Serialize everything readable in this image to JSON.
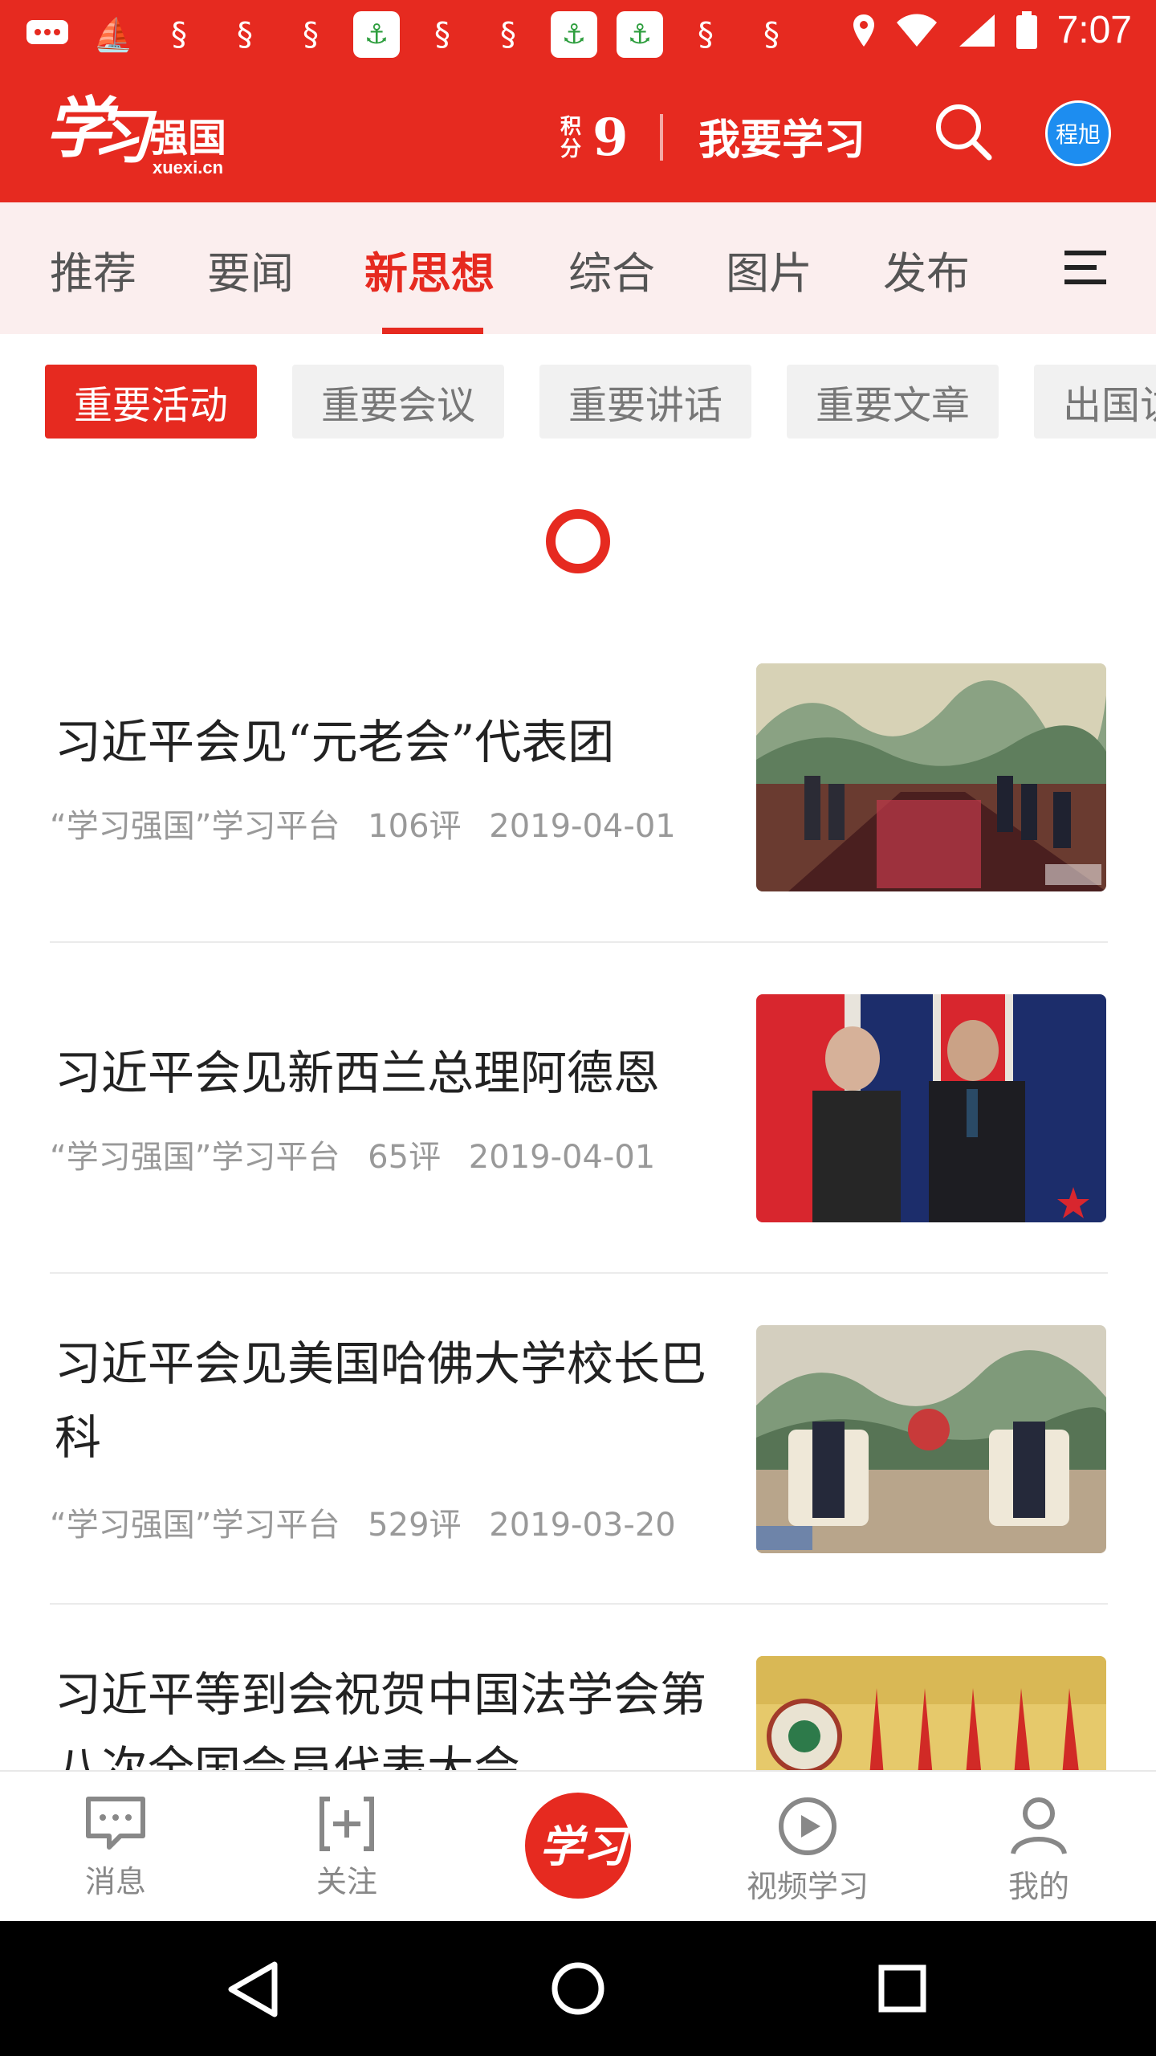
{
  "status_bar": {
    "time": "7:07",
    "notification_icons": [
      "message-icon",
      "app-notify-icon",
      "app-notify-icon",
      "app-notify-icon",
      "app-notify-icon",
      "app-notify-box-icon",
      "app-notify-icon",
      "app-notify-icon",
      "app-notify-box-icon",
      "app-notify-box-icon",
      "app-notify-icon",
      "app-notify-icon"
    ]
  },
  "header": {
    "logo_text": "学习强国",
    "logo_domain": "xuexi.cn",
    "score_label": "积分",
    "score_value": "9",
    "study_label": "我要学习",
    "avatar_text": "程旭",
    "accent_color": "#e62a20"
  },
  "tabs": {
    "items": [
      "推荐",
      "要闻",
      "新思想",
      "综合",
      "图片",
      "发布"
    ],
    "active_index": 2
  },
  "chips": {
    "items": [
      "重要活动",
      "重要会议",
      "重要讲话",
      "重要文章",
      "出国访"
    ],
    "active_index": 0
  },
  "articles": [
    {
      "title": "习近平会见“元老会”代表团",
      "source": "“学习强国”学习平台",
      "comments": "106评",
      "date": "2019-04-01"
    },
    {
      "title": "习近平会见新西兰总理阿德恩",
      "source": "“学习强国”学习平台",
      "comments": "65评",
      "date": "2019-04-01"
    },
    {
      "title": "习近平会见美国哈佛大学校长巴科",
      "source": "“学习强国”学习平台",
      "comments": "529评",
      "date": "2019-03-20"
    },
    {
      "title": "习近平等到会祝贺中国法学会第八次全国会员代表大会",
      "source": "",
      "comments": "",
      "date": ""
    }
  ],
  "bottom_nav": {
    "items": [
      "消息",
      "关注",
      "",
      "视频学习",
      "我的"
    ],
    "center_label": "学习"
  }
}
